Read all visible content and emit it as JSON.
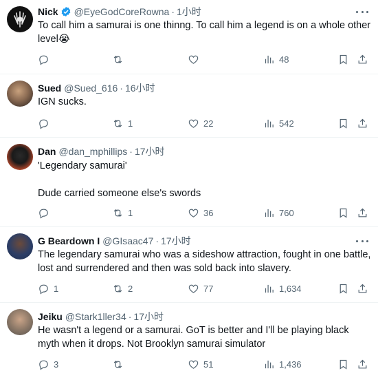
{
  "tweets": [
    {
      "name": "Nick",
      "handle": "@EyeGodCoreRowna",
      "time": "1小时",
      "verified": true,
      "text": "To call him a samurai is one thinng. To call him a legend is on a whole other level😭",
      "replies": "",
      "retweets": "",
      "likes": "",
      "views": "48"
    },
    {
      "name": "Sued",
      "handle": "@Sued_616",
      "time": "16小时",
      "verified": false,
      "text": "IGN sucks.",
      "replies": "",
      "retweets": "1",
      "likes": "22",
      "views": "542"
    },
    {
      "name": "Dan",
      "handle": "@dan_mphillips",
      "time": "17小时",
      "verified": false,
      "text": "'Legendary samurai'\n\nDude carried someone else's swords",
      "replies": "",
      "retweets": "1",
      "likes": "36",
      "views": "760"
    },
    {
      "name": "G Beardown I",
      "handle": "@GIsaac47",
      "time": "17小时",
      "verified": false,
      "text": "The legendary samurai who was a sideshow attraction, fought in one battle, lost and surrendered and then was sold back into slavery.",
      "replies": "1",
      "retweets": "2",
      "likes": "77",
      "views": "1,634"
    },
    {
      "name": "Jeiku",
      "handle": "@Stark1ller34",
      "time": "17小时",
      "verified": false,
      "text": "He wasn't a legend or a samurai. GoT is better and I'll be playing black myth when it drops. Not Brooklyn samurai simulator",
      "replies": "3",
      "retweets": "",
      "likes": "51",
      "views": "1,436"
    }
  ],
  "separator": "·",
  "colors": {
    "text": "#0f1419",
    "secondary": "#536471",
    "verified": "#1d9bf0",
    "border": "#eff3f4"
  }
}
